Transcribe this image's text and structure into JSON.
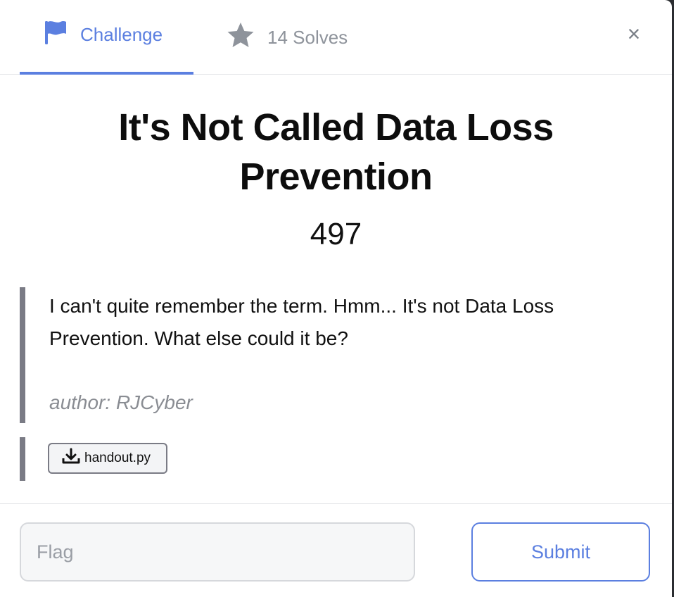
{
  "tabs": {
    "challenge_label": "Challenge",
    "solves_label": "14 Solves",
    "active": "challenge",
    "challenge_icon": "flag-icon",
    "solves_icon": "star-icon"
  },
  "close_glyph": "×",
  "challenge": {
    "title": "It's Not Called Data Loss Prevention",
    "points": "497",
    "description": "I can't quite remember the term. Hmm... It's not Data Loss Prevention. What else could it be?",
    "author": "author: RJCyber"
  },
  "files": [
    {
      "name": "handout.py",
      "icon": "download-icon"
    }
  ],
  "submission": {
    "flag_placeholder": "Flag",
    "flag_value": "",
    "submit_label": "Submit"
  },
  "colors": {
    "accent": "#5b7fe0",
    "muted": "#8e939b",
    "quote_bar": "#7a7b85"
  }
}
